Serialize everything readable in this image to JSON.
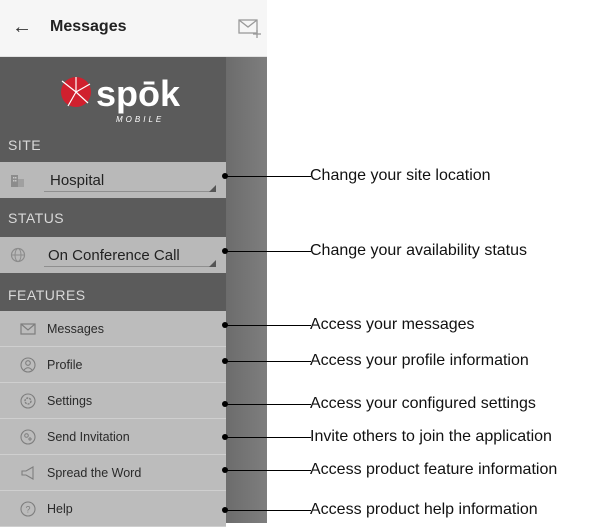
{
  "appbar": {
    "title": "Messages"
  },
  "logo": {
    "word": "spōk",
    "sub": "MOBILE"
  },
  "sections": {
    "site": "SITE",
    "status": "STATUS",
    "features": "FEATURES"
  },
  "site_select": {
    "value": "Hospital"
  },
  "status_select": {
    "value": "On Conference Call"
  },
  "features": [
    {
      "label": "Messages",
      "icon": "envelope-icon"
    },
    {
      "label": "Profile",
      "icon": "person-icon"
    },
    {
      "label": "Settings",
      "icon": "gear-icon"
    },
    {
      "label": "Send Invitation",
      "icon": "invite-icon"
    },
    {
      "label": "Spread the Word",
      "icon": "megaphone-icon"
    },
    {
      "label": "Help",
      "icon": "help-icon"
    }
  ],
  "callouts": [
    "Change your site location",
    "Change your availability status",
    "Access your messages",
    "Access your profile information",
    "Access your configured settings",
    "Invite others to join the application",
    "Access product feature information",
    "Access product help information"
  ],
  "colors": {
    "drawer": "#5b5b5b",
    "item": "#bcbcbc",
    "logo_red": "#d0202e"
  }
}
